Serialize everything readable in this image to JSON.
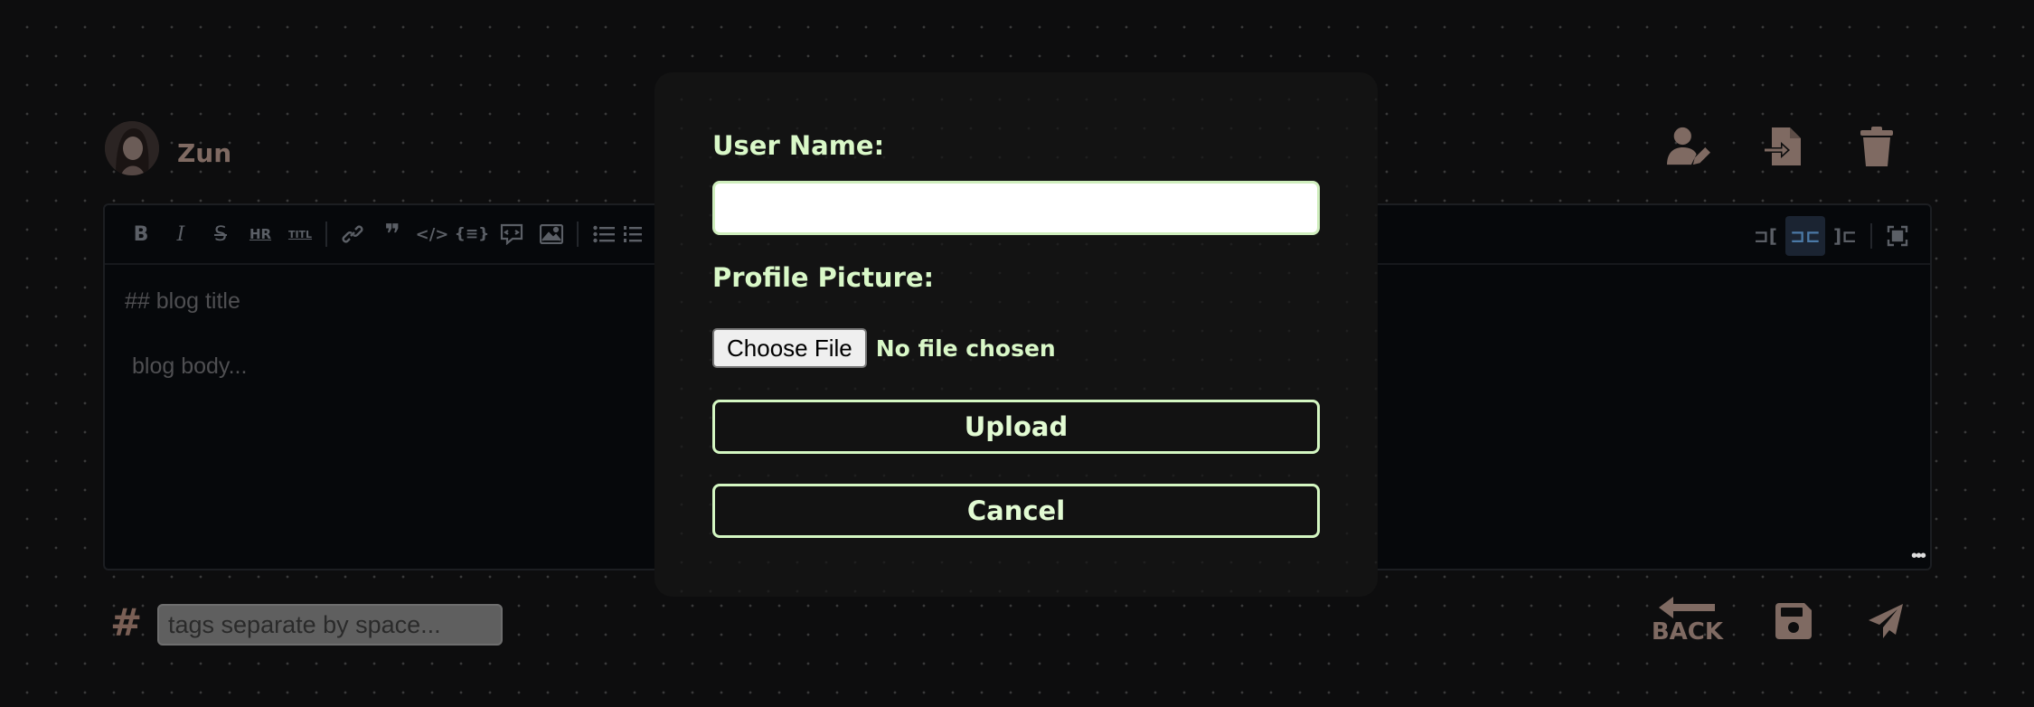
{
  "user": {
    "name": "Zun"
  },
  "editor": {
    "toolbar_left": [
      {
        "name": "bold-icon",
        "glyph": "B",
        "style": "bold"
      },
      {
        "name": "italic-icon",
        "glyph": "I",
        "style": "italic"
      },
      {
        "name": "strikethrough-icon",
        "glyph": "S",
        "style": "strike"
      },
      {
        "name": "horizontal-rule-icon",
        "glyph": "HR",
        "style": "small"
      },
      {
        "name": "title-icon",
        "glyph": "TITL",
        "style": "tiny"
      }
    ],
    "title_placeholder": "## blog title",
    "body_placeholder": "blog body..."
  },
  "tags": {
    "placeholder": "tags separate by space..."
  },
  "bottom": {
    "back_label": "BACK"
  },
  "modal": {
    "username_label": "User Name:",
    "username_value": "",
    "picture_label": "Profile Picture:",
    "choose_file_label": "Choose File",
    "no_file_text": "No file chosen",
    "upload_label": "Upload",
    "cancel_label": "Cancel"
  },
  "colors": {
    "accent": "#d9f8c8",
    "muted_brown": "#7f6a62",
    "modal_bg": "#131313"
  }
}
